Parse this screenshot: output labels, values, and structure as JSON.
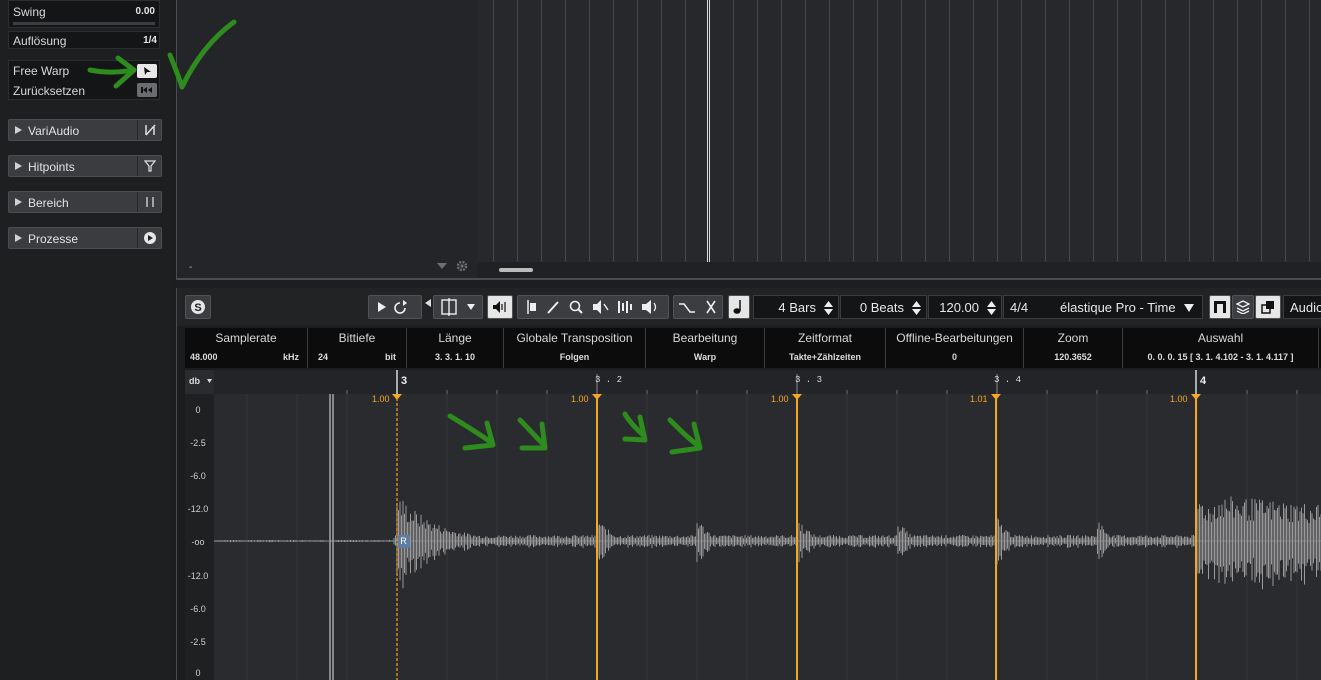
{
  "inspector": {
    "swing": {
      "label": "Swing",
      "value": "0.00"
    },
    "aufloesung": {
      "label": "Auflösung",
      "value": "1/4"
    },
    "free_warp": {
      "label": "Free Warp"
    },
    "zuruecksetzen": {
      "label": "Zurücksetzen"
    },
    "sections": [
      {
        "label": "VariAudio",
        "icon": "variaudio-icon"
      },
      {
        "label": "Hitpoints",
        "icon": "filter-icon"
      },
      {
        "label": "Bereich",
        "icon": "range-icon"
      },
      {
        "label": "Prozesse",
        "icon": "play-circle-icon"
      }
    ]
  },
  "upper": {
    "dash": "-"
  },
  "toolbar": {
    "bars": "4 Bars",
    "beats": "0 Beats",
    "tempo": "120.00",
    "signature": "4/4",
    "algorithm": "élastique Pro - Time",
    "audio_tab": "Audio"
  },
  "infoline": {
    "columns": [
      {
        "header": "Samplerate",
        "values": [
          "48.000",
          "kHz"
        ]
      },
      {
        "header": "Bittiefe",
        "values": [
          "24",
          "bit"
        ]
      },
      {
        "header": "Länge",
        "values": [
          "3. 3. 1. 10"
        ]
      },
      {
        "header": "Globale Transposition",
        "values": [
          "Folgen"
        ]
      },
      {
        "header": "Bearbeitung",
        "values": [
          "Warp"
        ]
      },
      {
        "header": "Zeitformat",
        "values": [
          "Takte+Zählzeiten"
        ]
      },
      {
        "header": "Offline-Bearbeitungen",
        "values": [
          "0"
        ]
      },
      {
        "header": "Zoom",
        "values": [
          "120.3652"
        ]
      },
      {
        "header": "Auswahl",
        "values": [
          "0. 0. 0. 15 [ 3. 1. 4.102 - 3. 1. 4.117 ]"
        ]
      }
    ]
  },
  "ruler": {
    "marks": [
      "3",
      "3 . 2",
      "3 . 3",
      "3 . 4",
      "4"
    ],
    "warp_values": [
      "1.00",
      "1.00",
      "1.00",
      "1.01",
      "1.00"
    ]
  },
  "db_scale": {
    "unit": "db",
    "labels": [
      "0",
      "-2.5",
      "-6.0",
      "-12.0",
      "-oo",
      "-12.0",
      "-6.0",
      "-2.5",
      "0"
    ]
  },
  "wave": {
    "region_marker": "R"
  },
  "colors": {
    "warp": "#f5a623",
    "annotation": "#2e8b1e",
    "wave": "#9a9a9a"
  }
}
